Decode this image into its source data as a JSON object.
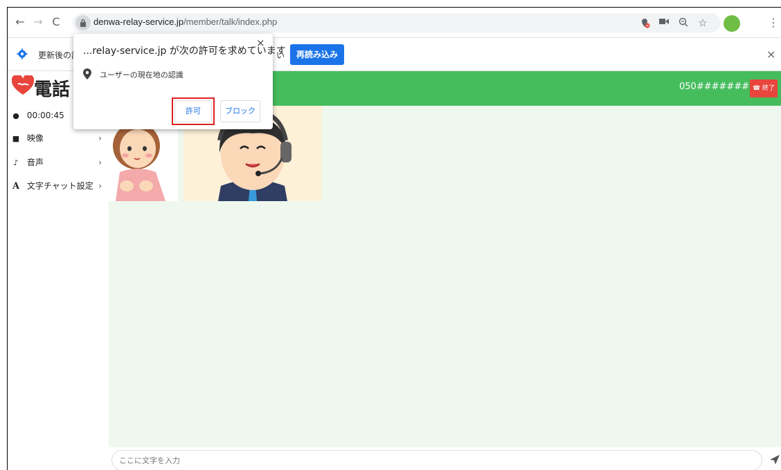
{
  "browser": {
    "url_host": "denwa-relay-service.jp",
    "url_path": "/member/talk/index.php"
  },
  "infobar": {
    "message": "更新後の設",
    "message_tail": "い",
    "reload_label": "再読み込み",
    "close": "×"
  },
  "permission": {
    "title": "...relay-service.jp が次の許可を求めています",
    "request": "ユーザーの現在地の認識",
    "allow_label": "許可",
    "block_label": "ブロック",
    "close": "×"
  },
  "header": {
    "logo_text": "電話",
    "phone_number": "050########",
    "end_label": "終了",
    "sign_label": "手話"
  },
  "sidebar": {
    "timer": "00:00:45",
    "items": [
      {
        "label": "映像"
      },
      {
        "label": "音声"
      },
      {
        "label": "文字チャット設定"
      }
    ]
  },
  "chat": {
    "placeholder": "ここに文字を入力"
  },
  "colors": {
    "header_green": "#46bd5d",
    "main_bg": "#eff8ef",
    "end_red": "#e8453c",
    "chrome_blue": "#1a73e8"
  }
}
